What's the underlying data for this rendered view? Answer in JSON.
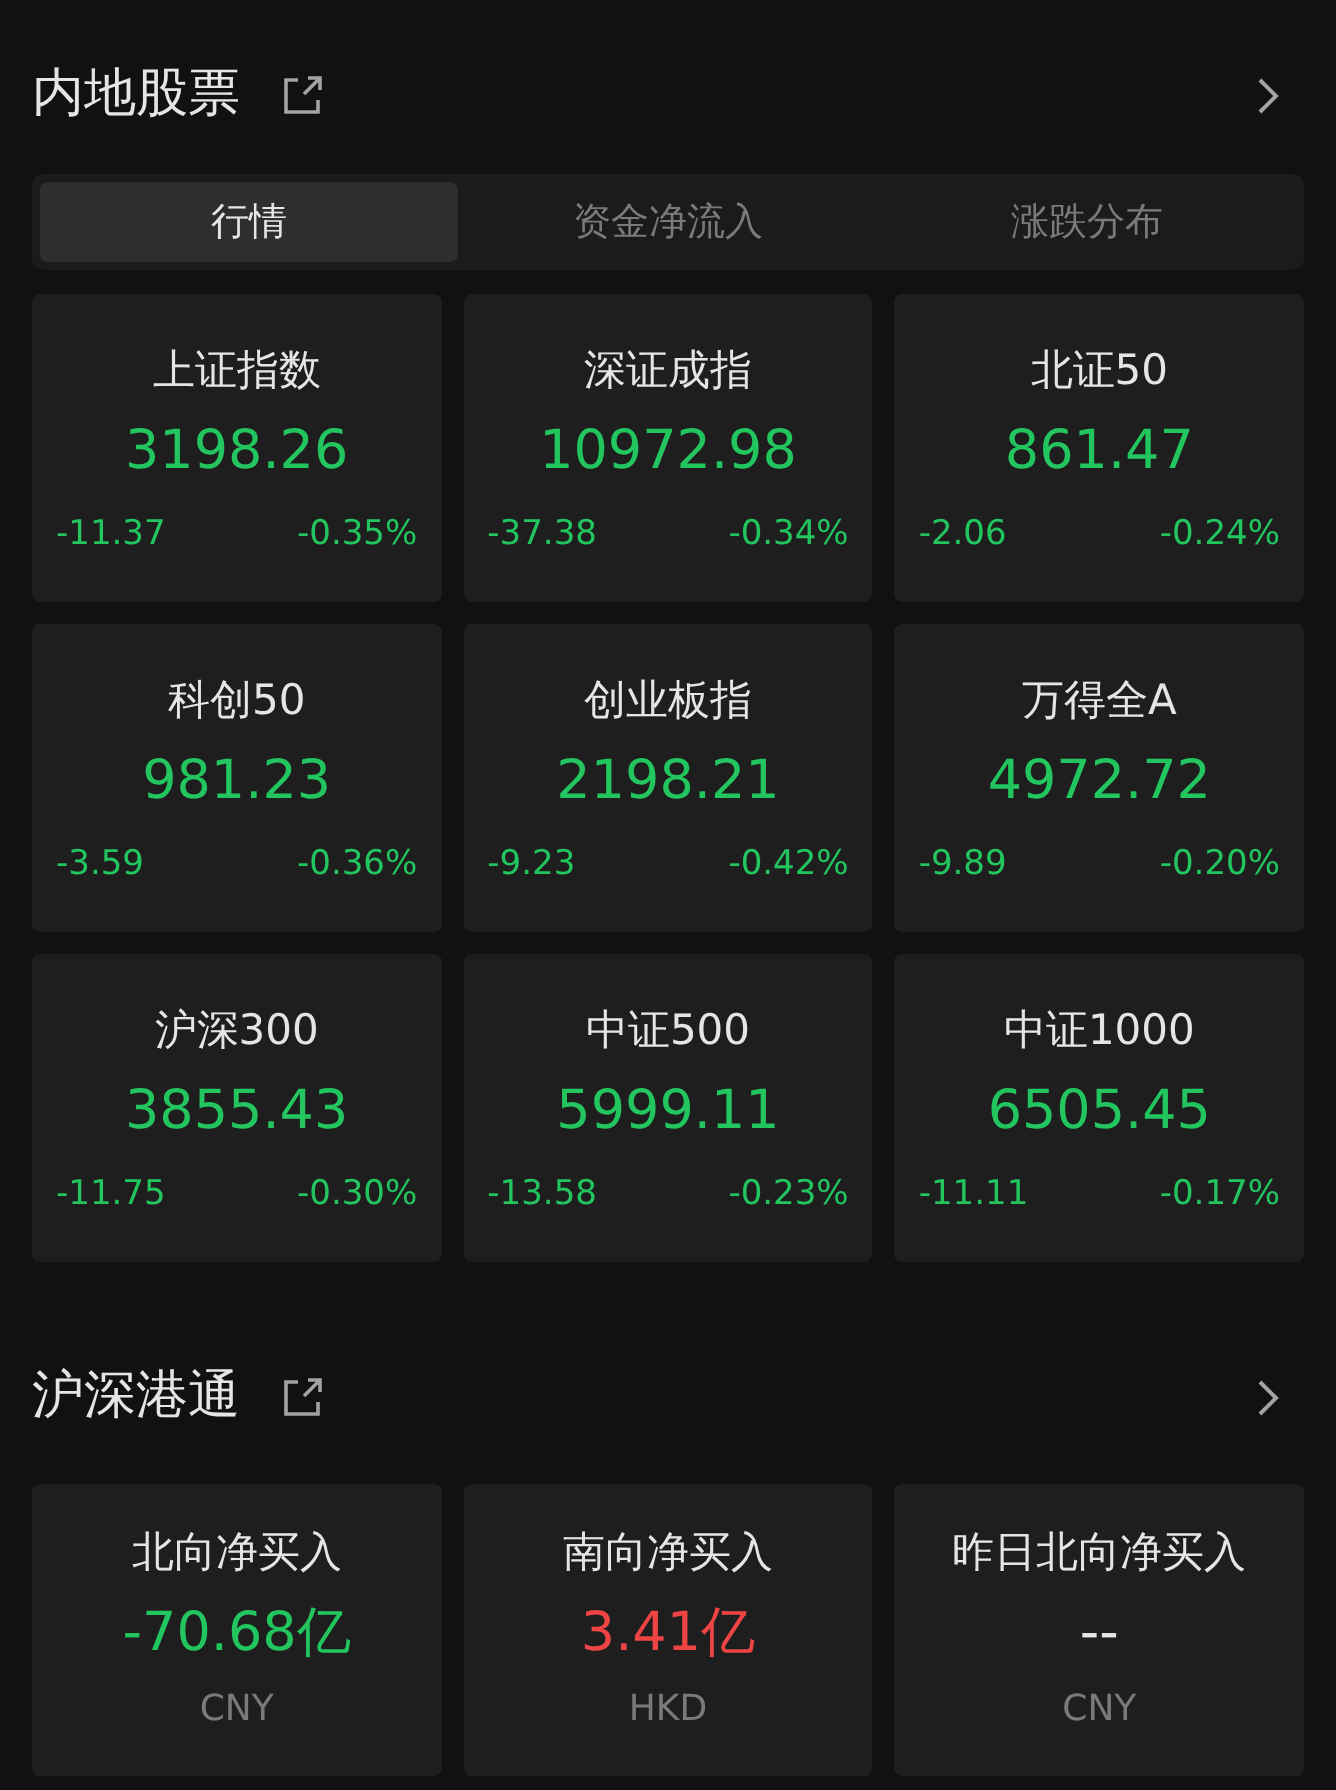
{
  "market": {
    "title": "内地股票",
    "tabs": [
      {
        "label": "行情",
        "selected": true
      },
      {
        "label": "资金净流入",
        "selected": false
      },
      {
        "label": "涨跌分布",
        "selected": false
      }
    ],
    "indices": [
      {
        "name": "上证指数",
        "value": "3198.26",
        "change": "-11.37",
        "percent": "-0.35%",
        "color": "#22c55e"
      },
      {
        "name": "深证成指",
        "value": "10972.98",
        "change": "-37.38",
        "percent": "-0.34%",
        "color": "#22c55e"
      },
      {
        "name": "北证50",
        "value": "861.47",
        "change": "-2.06",
        "percent": "-0.24%",
        "color": "#22c55e"
      },
      {
        "name": "科创50",
        "value": "981.23",
        "change": "-3.59",
        "percent": "-0.36%",
        "color": "#22c55e"
      },
      {
        "name": "创业板指",
        "value": "2198.21",
        "change": "-9.23",
        "percent": "-0.42%",
        "color": "#22c55e"
      },
      {
        "name": "万得全A",
        "value": "4972.72",
        "change": "-9.89",
        "percent": "-0.20%",
        "color": "#22c55e"
      },
      {
        "name": "沪深300",
        "value": "3855.43",
        "change": "-11.75",
        "percent": "-0.30%",
        "color": "#22c55e"
      },
      {
        "name": "中证500",
        "value": "5999.11",
        "change": "-13.58",
        "percent": "-0.23%",
        "color": "#22c55e"
      },
      {
        "name": "中证1000",
        "value": "6505.45",
        "change": "-11.11",
        "percent": "-0.17%",
        "color": "#22c55e"
      }
    ]
  },
  "connect": {
    "title": "沪深港通",
    "flows": [
      {
        "name": "北向净买入",
        "value": "-70.68亿",
        "currency": "CNY",
        "color": "#22c55e"
      },
      {
        "name": "南向净买入",
        "value": "3.41亿",
        "currency": "HKD",
        "color": "#ef4444"
      },
      {
        "name": "昨日北向净买入",
        "value": "--",
        "currency": "CNY",
        "color": "#e5e5e5"
      }
    ]
  }
}
